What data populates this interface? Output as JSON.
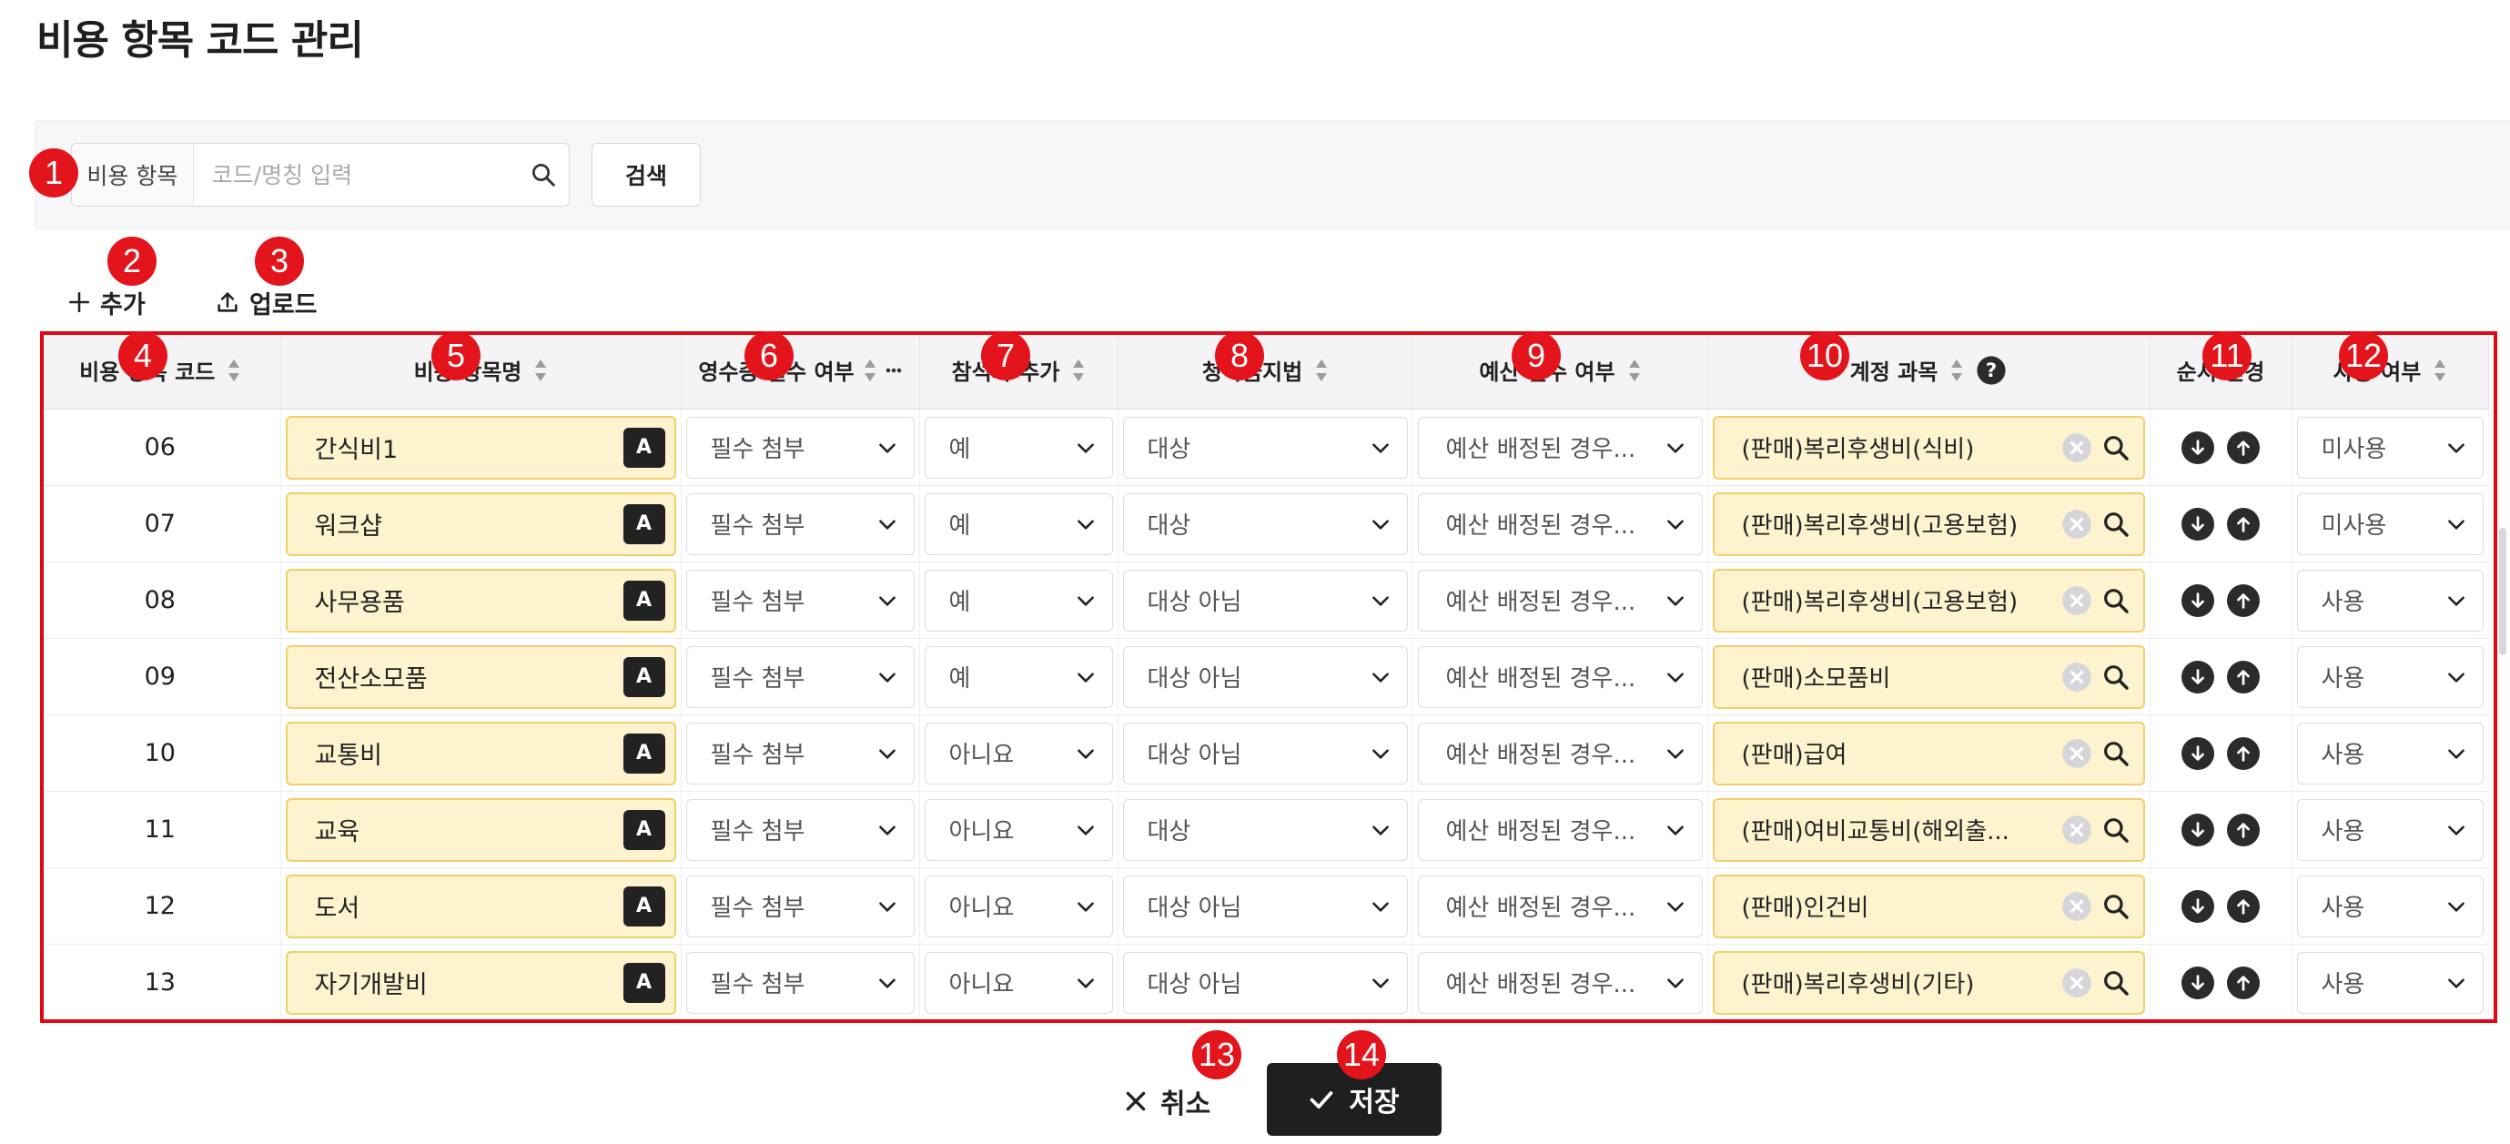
{
  "page": {
    "title": "비용 항목 코드 관리"
  },
  "search": {
    "label": "비용 항목",
    "placeholder": "코드/명칭 입력",
    "button_label": "검색"
  },
  "toolbar": {
    "add_label": "추가",
    "upload_label": "업로드"
  },
  "table": {
    "headers": {
      "code": "비용 항목 코드",
      "name": "비용 항목명",
      "receipt": "영수증 필수 여부",
      "attendee": "참석자 추가",
      "antigraft": "청탁금지법",
      "budget": "예산 필수 여부",
      "account": "계정 과목",
      "order": "순서 변경",
      "use": "사용 여부"
    },
    "lang_badge": "A",
    "rows": [
      {
        "code": "06",
        "name": "간식비1",
        "receipt": "필수 첨부",
        "attendee": "예",
        "antigraft": "대상",
        "budget": "예산 배정된 경우...",
        "account": "(판매)복리후생비(식비)",
        "use": "미사용"
      },
      {
        "code": "07",
        "name": "워크샵",
        "receipt": "필수 첨부",
        "attendee": "예",
        "antigraft": "대상",
        "budget": "예산 배정된 경우...",
        "account": "(판매)복리후생비(고용보험)",
        "use": "미사용"
      },
      {
        "code": "08",
        "name": "사무용품",
        "receipt": "필수 첨부",
        "attendee": "예",
        "antigraft": "대상 아님",
        "budget": "예산 배정된 경우...",
        "account": "(판매)복리후생비(고용보험)",
        "use": "사용"
      },
      {
        "code": "09",
        "name": "전산소모품",
        "receipt": "필수 첨부",
        "attendee": "예",
        "antigraft": "대상 아님",
        "budget": "예산 배정된 경우...",
        "account": "(판매)소모품비",
        "use": "사용"
      },
      {
        "code": "10",
        "name": "교통비",
        "receipt": "필수 첨부",
        "attendee": "아니요",
        "antigraft": "대상 아님",
        "budget": "예산 배정된 경우...",
        "account": "(판매)급여",
        "use": "사용"
      },
      {
        "code": "11",
        "name": "교육",
        "receipt": "필수 첨부",
        "attendee": "아니요",
        "antigraft": "대상",
        "budget": "예산 배정된 경우...",
        "account": "(판매)여비교통비(해외출...",
        "use": "사용"
      },
      {
        "code": "12",
        "name": "도서",
        "receipt": "필수 첨부",
        "attendee": "아니요",
        "antigraft": "대상 아님",
        "budget": "예산 배정된 경우...",
        "account": "(판매)인건비",
        "use": "사용"
      },
      {
        "code": "13",
        "name": "자기개발비",
        "receipt": "필수 첨부",
        "attendee": "아니요",
        "antigraft": "대상 아님",
        "budget": "예산 배정된 경우...",
        "account": "(판매)복리후생비(기타)",
        "use": "사용"
      }
    ]
  },
  "footer": {
    "cancel_label": "취소",
    "save_label": "저장"
  },
  "annotations": [
    "1",
    "2",
    "3",
    "4",
    "5",
    "6",
    "7",
    "8",
    "9",
    "10",
    "11",
    "12",
    "13",
    "14"
  ],
  "colors": {
    "highlight_frame": "#e30613",
    "badge": "#e3141b",
    "editable_field_bg": "#fdf4cf",
    "editable_field_border": "#f2cf6a",
    "primary_button": "#1f1f1f"
  }
}
